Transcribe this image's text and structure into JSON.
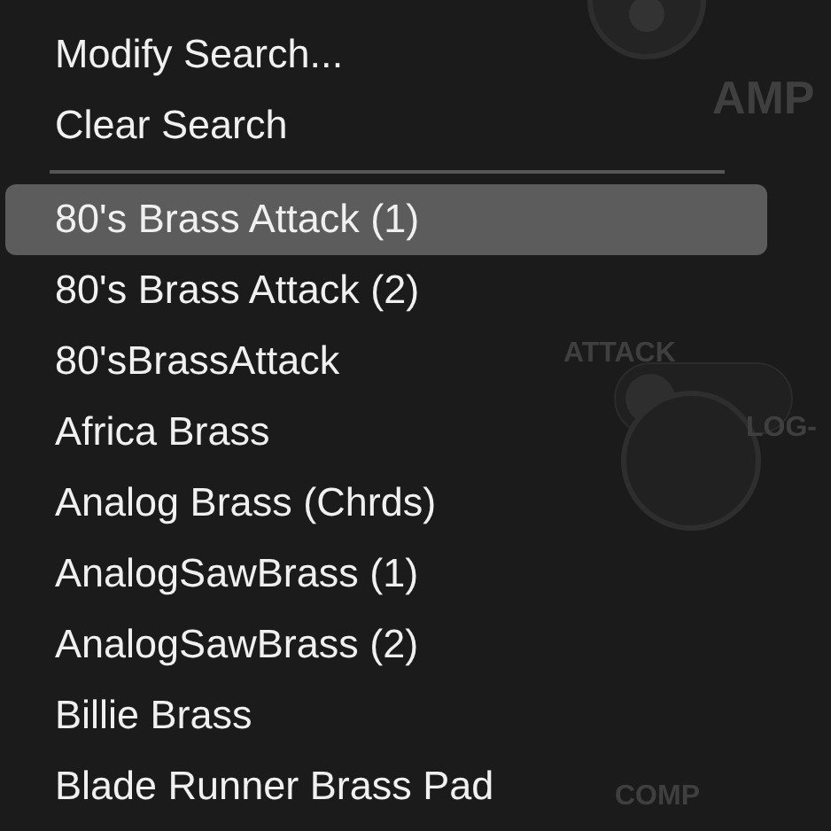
{
  "background_panel": {
    "labels": [
      {
        "text": "AMP",
        "kind": "heading"
      },
      {
        "text": "ATTACK",
        "kind": "label"
      },
      {
        "text": "LOG-",
        "kind": "label"
      },
      {
        "text": "COMP",
        "kind": "label"
      }
    ]
  },
  "menu": {
    "actions": [
      "Modify Search...",
      "Clear Search"
    ],
    "items": [
      {
        "label": "80's Brass Attack (1)",
        "selected": true
      },
      {
        "label": "80's Brass Attack (2)",
        "selected": false
      },
      {
        "label": "80'sBrassAttack",
        "selected": false
      },
      {
        "label": "Africa Brass",
        "selected": false
      },
      {
        "label": "Analog Brass (Chrds)",
        "selected": false
      },
      {
        "label": "AnalogSawBrass (1)",
        "selected": false
      },
      {
        "label": "AnalogSawBrass (2)",
        "selected": false
      },
      {
        "label": "Billie Brass",
        "selected": false
      },
      {
        "label": "Blade Runner Brass Pad",
        "selected": false
      }
    ]
  }
}
